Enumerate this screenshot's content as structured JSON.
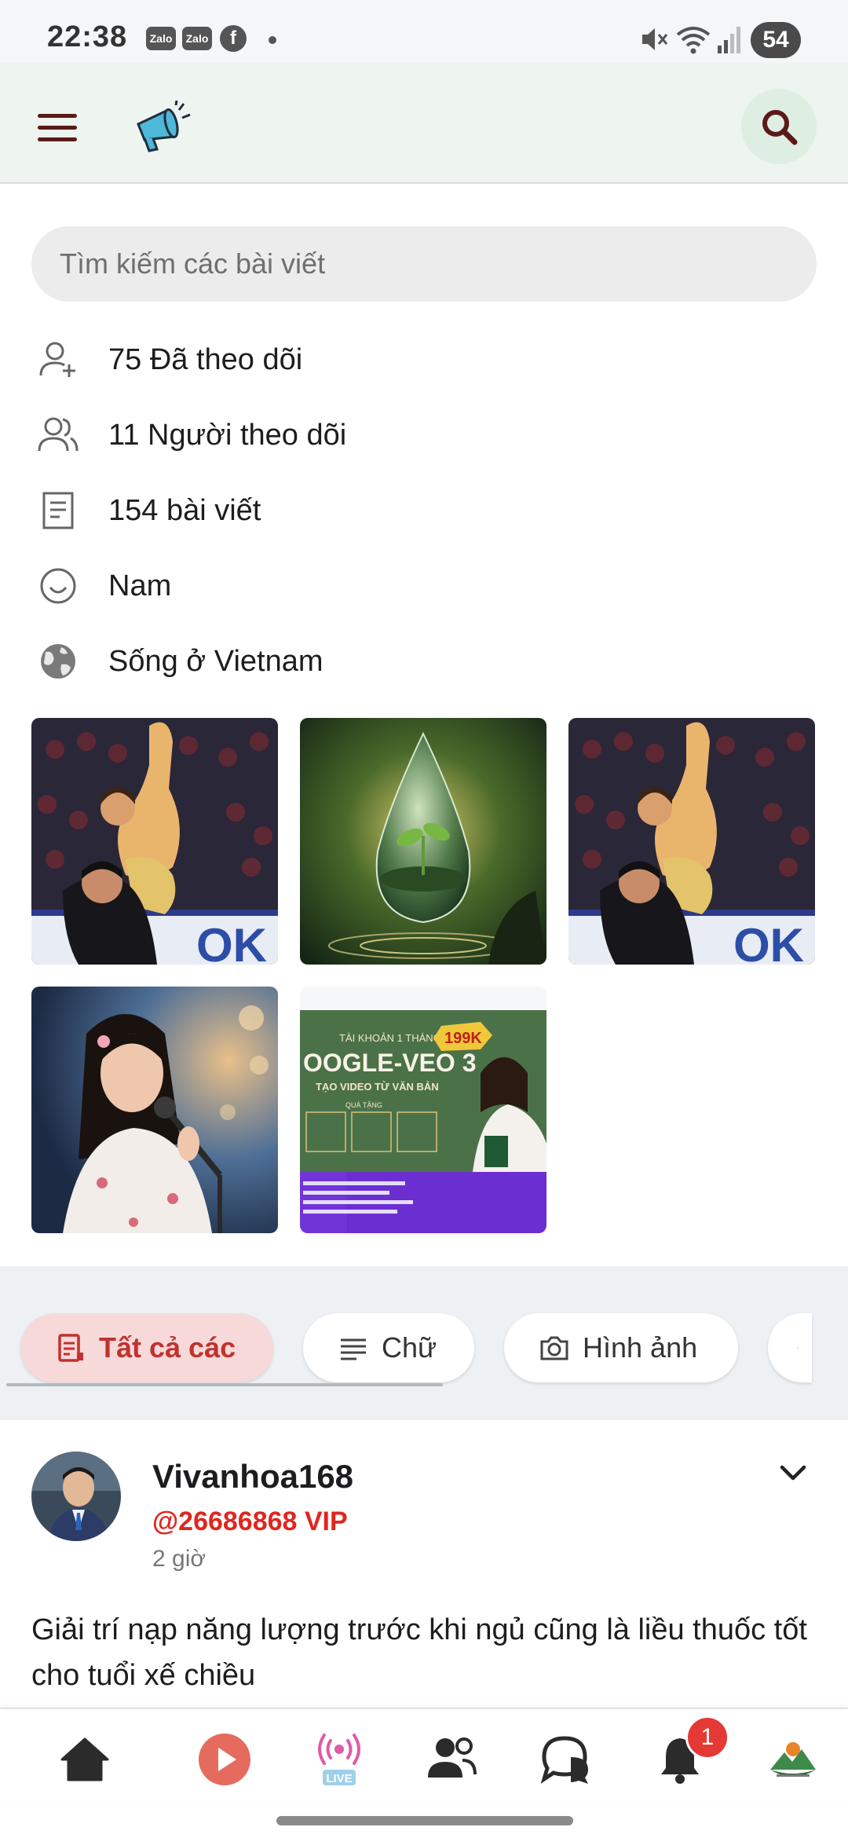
{
  "status_bar": {
    "time": "22:38",
    "notification_icons": [
      "Zalo",
      "Zalo"
    ],
    "facebook_glyph": "f",
    "battery": "54"
  },
  "app_bar": {
    "menu_icon": "menu-icon",
    "logo_icon": "megaphone-icon",
    "search_icon": "search-icon"
  },
  "profile": {
    "search_placeholder": "Tìm kiếm các bài viết",
    "info": [
      {
        "icon": "add-user-icon",
        "text": "75 Đã theo dõi"
      },
      {
        "icon": "users-icon",
        "text": "11 Người theo dõi"
      },
      {
        "icon": "document-icon",
        "text": "154 bài viết"
      },
      {
        "icon": "smile-icon",
        "text": "Nam"
      },
      {
        "icon": "globe-icon",
        "text": "Sống ở Vietnam"
      }
    ],
    "photos": [
      {
        "icon": "photo-figure-skating"
      },
      {
        "icon": "photo-water-drop-plant"
      },
      {
        "icon": "photo-figure-skating"
      },
      {
        "icon": "photo-woman-singing"
      },
      {
        "icon": "photo-google-veo-ad",
        "ad_badge": "199K",
        "ad_title": "OOGLE-VEO 3",
        "ad_top": "TÀI KHOẢN 1 THÁNG",
        "ad_sub": "TẠO VIDEO TỪ VĂN BẢN",
        "ad_gift": "QUÀ TẶNG"
      }
    ]
  },
  "filters": [
    {
      "label": "Tất cả các",
      "icon": "document-icon",
      "active": true
    },
    {
      "label": "Chữ",
      "icon": "text-lines-icon",
      "active": false
    },
    {
      "label": "Hình ảnh",
      "icon": "camera-icon",
      "active": false
    },
    {
      "label": "",
      "icon": "document-icon",
      "active": false
    }
  ],
  "post": {
    "author": "Vivanhoa168",
    "handle": "@26686868 VIP",
    "time": "2 giờ",
    "text": "Giải trí nạp năng lượng trước khi ngủ cũng là liều thuốc tốt cho tuổi xế chiều",
    "menu_icon": "chevron-down-icon"
  },
  "bottom_nav": {
    "items": [
      "home-icon",
      "play-icon",
      "live-icon",
      "friends-icon",
      "chat-icon",
      "bell-icon",
      "profile-avatar-icon"
    ],
    "live_label": "LIVE",
    "notification_count": "1"
  },
  "colors": {
    "accent": "#c0322f",
    "vip": "#e0261e",
    "app_bar_bg": "#eef4ef",
    "live_pink": "#e05aa8"
  }
}
